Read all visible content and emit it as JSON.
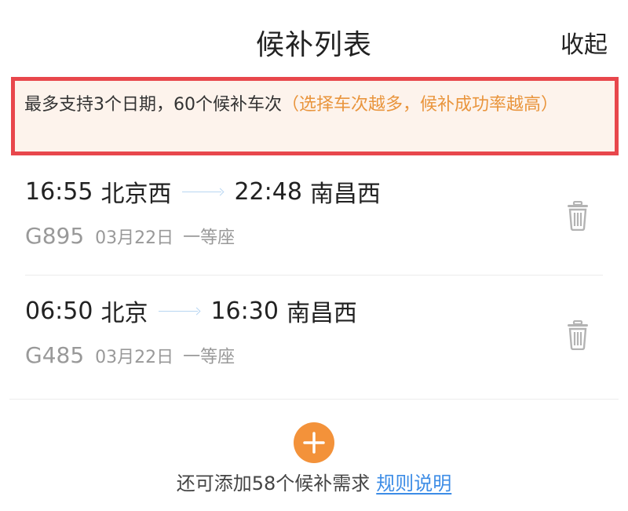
{
  "header": {
    "title": "候补列表",
    "collapse_label": "收起"
  },
  "notice": {
    "main": "最多支持3个日期，60个候补车次",
    "hint": "（选择车次越多，候补成功率越高）"
  },
  "trips": [
    {
      "depart_time": "16:55",
      "depart_station": "北京西",
      "arrive_time": "22:48",
      "arrive_station": "南昌西",
      "train_no": "G895",
      "date": "03月22日",
      "seat": "一等座",
      "delete_icon": "trash-icon"
    },
    {
      "depart_time": "06:50",
      "depart_station": "北京",
      "arrive_time": "16:30",
      "arrive_station": "南昌西",
      "train_no": "G485",
      "date": "03月22日",
      "seat": "一等座",
      "delete_icon": "trash-icon"
    }
  ],
  "footer": {
    "add_icon": "plus-icon",
    "remaining_text": "还可添加58个候补需求",
    "rules_link": "规则说明"
  },
  "colors": {
    "accent_orange": "#f3923a",
    "notice_border": "#e8474c",
    "notice_bg": "#fdf3ec",
    "hint_text": "#e9953d",
    "link_blue": "#3c8ce6",
    "muted_text": "#999999"
  }
}
